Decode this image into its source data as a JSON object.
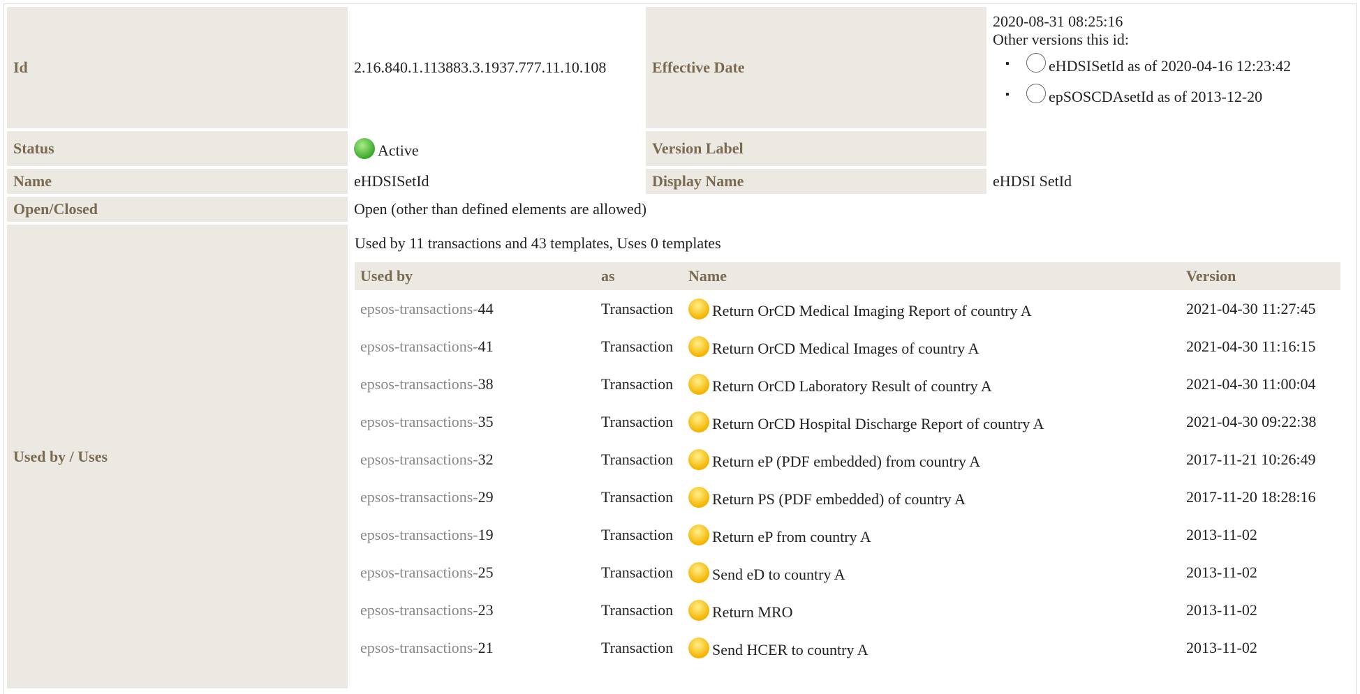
{
  "details": {
    "id_label": "Id",
    "id_value": "2.16.840.1.113883.3.1937.777.11.10.108",
    "effective_label": "Effective Date",
    "effective_value": "2020-08-31 08:25:16",
    "other_versions_label": "Other versions this id:",
    "other_versions": [
      {
        "name": "eHDSISetId",
        "as_of": "as of 2020-04-16 12:23:42"
      },
      {
        "name": "epSOSCDAsetId",
        "as_of": "as of 2013-12-20"
      }
    ],
    "status_label": "Status",
    "status_value": "Active",
    "status_color": "#3aa82a",
    "version_label_label": "Version Label",
    "name_label": "Name",
    "name_value": "eHDSISetId",
    "display_name_label": "Display Name",
    "display_name_value": "eHDSI SetId",
    "open_closed_label": "Open/Closed",
    "open_closed_value": "Open (other than defined elements are allowed)",
    "used_by_uses_label": "Used by / Uses"
  },
  "usage": {
    "summary": "Used by 11 transactions and 43 templates, Uses 0 templates",
    "columns": [
      "Used by",
      "as",
      "Name",
      "Version"
    ],
    "rows": [
      {
        "prefix": "epsos-transactions-",
        "num": "44",
        "as": "Transaction",
        "name": "Return OrCD Medical Imaging Report of country A",
        "version": "2021-04-30 11:27:45"
      },
      {
        "prefix": "epsos-transactions-",
        "num": "41",
        "as": "Transaction",
        "name": "Return OrCD Medical Images of country A",
        "version": "2021-04-30 11:16:15"
      },
      {
        "prefix": "epsos-transactions-",
        "num": "38",
        "as": "Transaction",
        "name": "Return OrCD Laboratory Result of country A",
        "version": "2021-04-30 11:00:04"
      },
      {
        "prefix": "epsos-transactions-",
        "num": "35",
        "as": "Transaction",
        "name": "Return OrCD Hospital Discharge Report of country A",
        "version": "2021-04-30 09:22:38"
      },
      {
        "prefix": "epsos-transactions-",
        "num": "32",
        "as": "Transaction",
        "name": "Return eP (PDF embedded) from country A",
        "version": "2017-11-21 10:26:49"
      },
      {
        "prefix": "epsos-transactions-",
        "num": "29",
        "as": "Transaction",
        "name": "Return PS (PDF embedded) of country A",
        "version": "2017-11-20 18:28:16"
      },
      {
        "prefix": "epsos-transactions-",
        "num": "19",
        "as": "Transaction",
        "name": "Return eP from country A",
        "version": "2013-11-02"
      },
      {
        "prefix": "epsos-transactions-",
        "num": "25",
        "as": "Transaction",
        "name": "Send eD to country A",
        "version": "2013-11-02"
      },
      {
        "prefix": "epsos-transactions-",
        "num": "23",
        "as": "Transaction",
        "name": "Return MRO",
        "version": "2013-11-02"
      },
      {
        "prefix": "epsos-transactions-",
        "num": "21",
        "as": "Transaction",
        "name": "Send HCER to country A",
        "version": "2013-11-02"
      }
    ],
    "status_icon_color": "#f4b400"
  }
}
